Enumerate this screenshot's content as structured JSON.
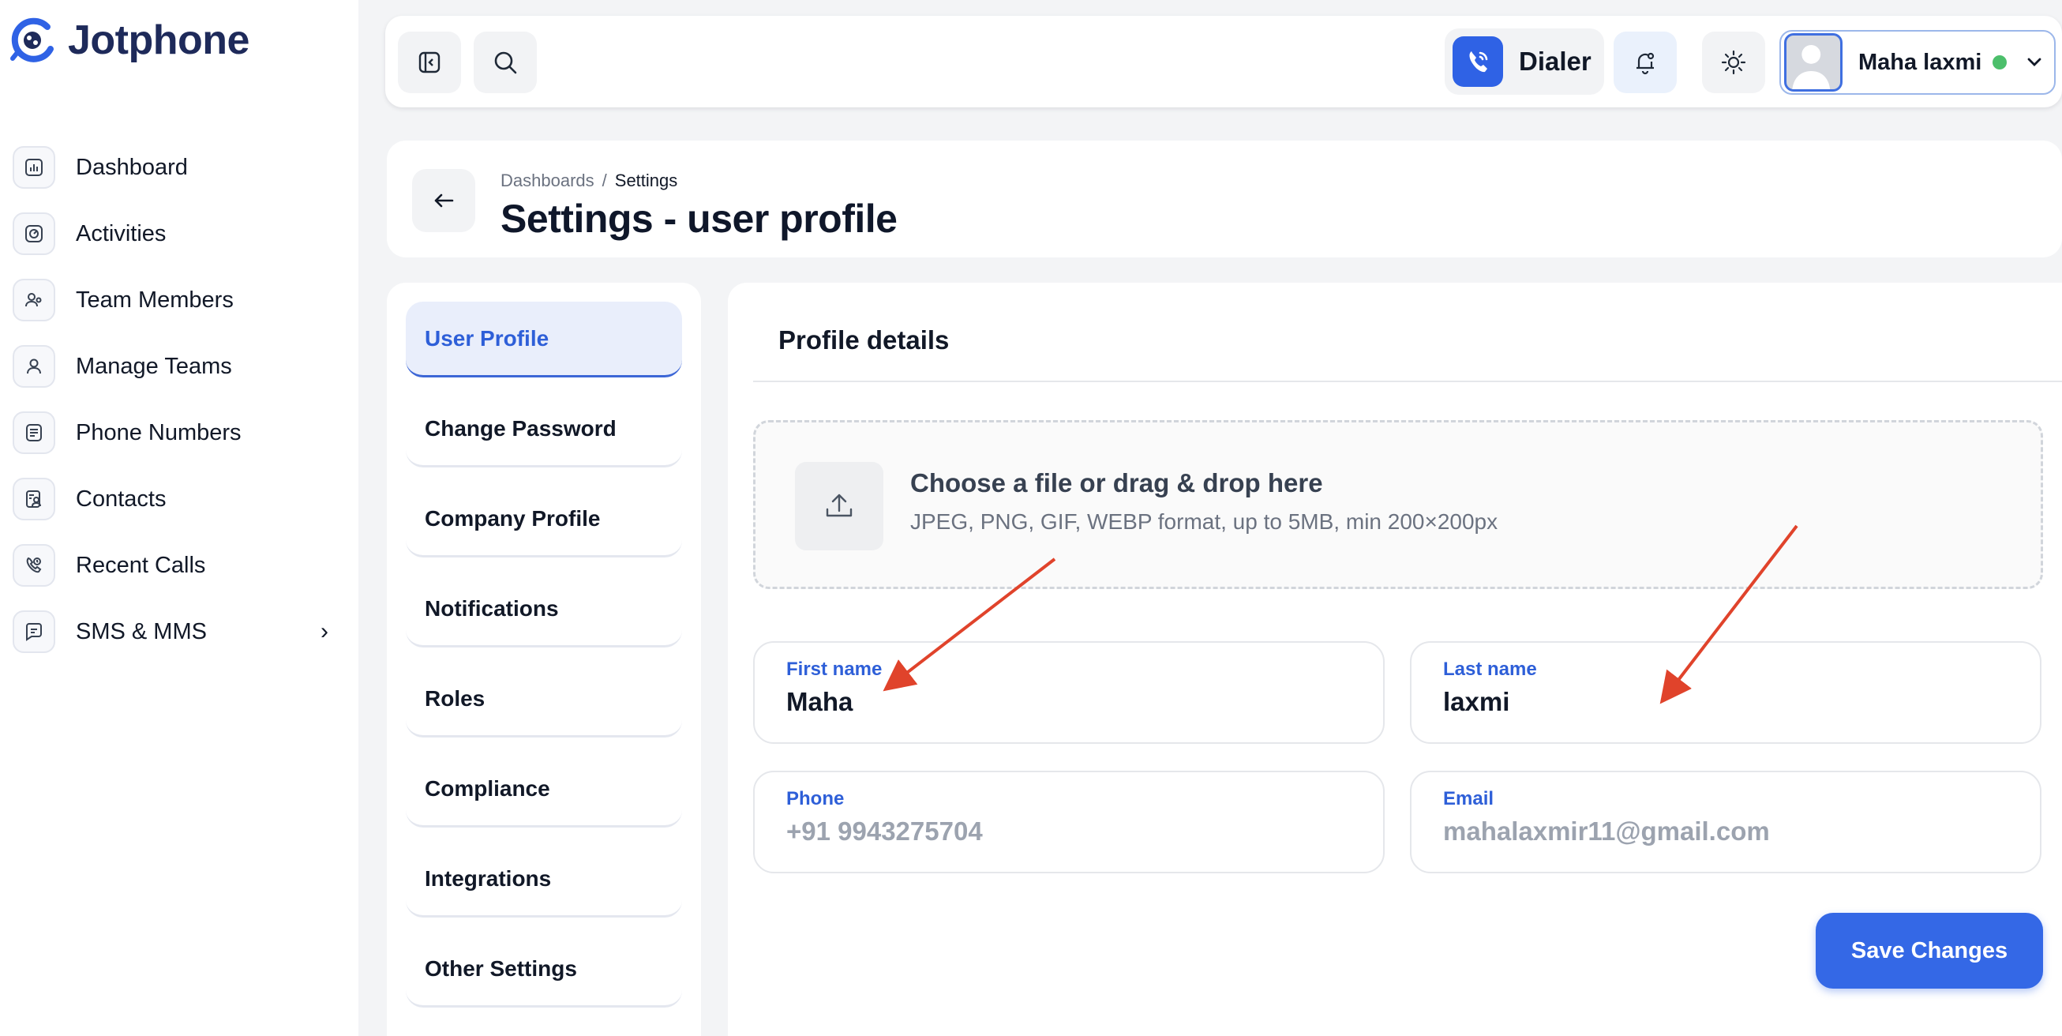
{
  "brand": {
    "name": "Jotphone"
  },
  "sidebar": {
    "items": [
      {
        "label": "Dashboard",
        "icon": "chart-icon"
      },
      {
        "label": "Activities",
        "icon": "activity-icon"
      },
      {
        "label": "Team Members",
        "icon": "team-members-icon"
      },
      {
        "label": "Manage Teams",
        "icon": "users-icon"
      },
      {
        "label": "Phone Numbers",
        "icon": "list-icon"
      },
      {
        "label": "Contacts",
        "icon": "contacts-icon"
      },
      {
        "label": "Recent Calls",
        "icon": "phone-call-icon"
      },
      {
        "label": "SMS & MMS",
        "icon": "message-icon",
        "chevron": "›"
      }
    ]
  },
  "topbar": {
    "dialer_label": "Dialer",
    "user_name": "Maha laxmi",
    "status_color": "#4cbf6b"
  },
  "header": {
    "breadcrumb": [
      "Dashboards",
      "/",
      "Settings"
    ],
    "title": "Settings - user profile"
  },
  "settings_menu": {
    "items": [
      "User Profile",
      "Change Password",
      "Company Profile",
      "Notifications",
      "Roles",
      "Compliance",
      "Integrations",
      "Other Settings"
    ],
    "active_index": 0
  },
  "profile": {
    "title": "Profile details",
    "upload": {
      "title": "Choose a file or drag & drop here",
      "hint": "JPEG, PNG, GIF, WEBP format, up to 5MB, min 200×200px"
    },
    "fields": {
      "first_name": {
        "label": "First name",
        "value": "Maha"
      },
      "last_name": {
        "label": "Last name",
        "value": "laxmi"
      },
      "phone": {
        "label": "Phone",
        "value": "+91 9943275704"
      },
      "email": {
        "label": "Email",
        "value": "mahalaxmir11@gmail.com"
      }
    },
    "save_label": "Save Changes"
  },
  "colors": {
    "accent": "#3468e6",
    "brand": "#1e2a5a",
    "annotation_arrow": "#e0432b"
  }
}
